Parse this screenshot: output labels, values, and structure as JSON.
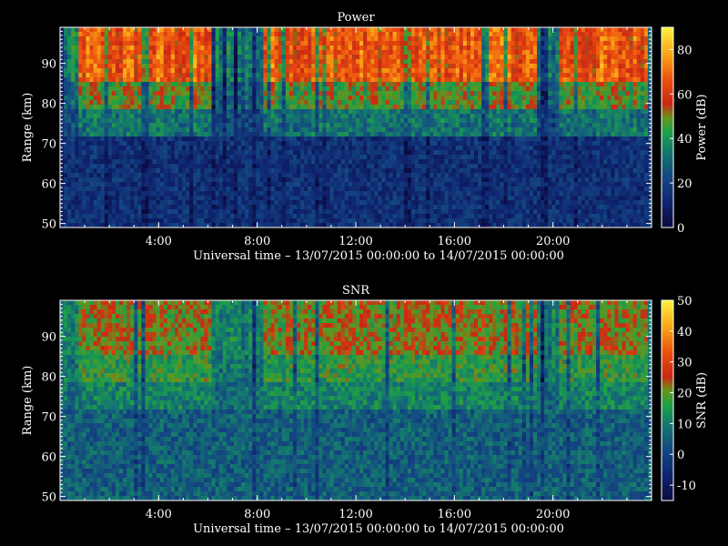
{
  "chart_data": [
    {
      "type": "heatmap",
      "title": "Power",
      "xlabel": "Universal time – 13/07/2015 00:00:00 to 14/07/2015 00:00:00",
      "ylabel": "Range (km)",
      "x_ticks": [
        "4:00",
        "8:00",
        "12:00",
        "16:00",
        "20:00"
      ],
      "x_range_hours": [
        0,
        24
      ],
      "y_ticks": [
        50,
        60,
        70,
        80,
        90
      ],
      "y_range_km": [
        49,
        99
      ],
      "colorbar": {
        "label": "Power (dB)",
        "ticks": [
          0,
          20,
          40,
          60,
          80
        ],
        "range": [
          0,
          90
        ]
      },
      "description_values": {
        "low_altitude_level": 15,
        "upper_altitude_level": 75,
        "enhanced_intervals_hours": [
          [
            0.8,
            6.2
          ],
          [
            8.3,
            19.3
          ],
          [
            20.3,
            23.8
          ]
        ]
      }
    },
    {
      "type": "heatmap",
      "title": "SNR",
      "xlabel": "Universal time – 13/07/2015 00:00:00 to 14/07/2015 00:00:00",
      "ylabel": "Range (km)",
      "x_ticks": [
        "4:00",
        "8:00",
        "12:00",
        "16:00",
        "20:00"
      ],
      "x_range_hours": [
        0,
        24
      ],
      "y_ticks": [
        50,
        60,
        70,
        80,
        90
      ],
      "y_range_km": [
        49,
        99
      ],
      "colorbar": {
        "label": "SNR (dB)",
        "ticks": [
          -10,
          0,
          10,
          20,
          30,
          40,
          50
        ],
        "range": [
          -15,
          50
        ]
      },
      "description_values": {
        "low_altitude_level": 5,
        "upper_altitude_level": 25,
        "enhanced_intervals_hours": [
          [
            0.8,
            6.2
          ],
          [
            8.3,
            19.3
          ],
          [
            20.3,
            23.8
          ]
        ]
      }
    }
  ]
}
